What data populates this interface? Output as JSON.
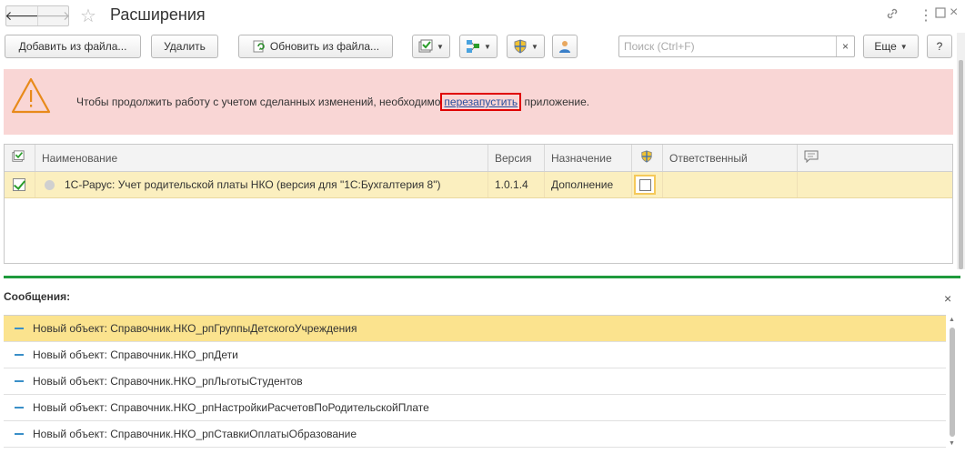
{
  "window": {
    "title": "Расширения",
    "nav_back_icon": "arrow-left-icon",
    "nav_forward_icon": "arrow-right-icon",
    "favorite_icon": "star-icon",
    "link_icon": "link-icon",
    "menu_icon": "more-vertical-icon",
    "maximize_icon": "maximize-icon",
    "close_icon": "close-icon"
  },
  "toolbar": {
    "add_from_file": "Добавить из файла...",
    "delete": "Удалить",
    "update_from_file": "Обновить из файла...",
    "search_placeholder": "Поиск (Ctrl+F)",
    "search_clear": "×",
    "more": "Еще",
    "help": "?"
  },
  "warning": {
    "text_before": "Чтобы продолжить работу с учетом сделанных изменений, необходимо",
    "link": "перезапустить",
    "text_after": " приложение."
  },
  "table": {
    "columns": {
      "name": "Наименование",
      "version": "Версия",
      "purpose": "Назначение",
      "responsible": "Ответственный"
    },
    "rows": [
      {
        "checked": true,
        "name": "1С-Рарус: Учет родительской платы НКО (версия для \"1С:Бухгалтерия 8\")",
        "version": "1.0.1.4",
        "purpose": "Дополнение",
        "safe_mode": false,
        "responsible": ""
      }
    ]
  },
  "messages": {
    "title": "Сообщения:",
    "close": "×",
    "items": [
      "Новый объект: Справочник.НКО_рпГруппыДетскогоУчреждения",
      "Новый объект: Справочник.НКО_рпДети",
      "Новый объект: Справочник.НКО_рпЛьготыСтудентов",
      "Новый объект: Справочник.НКО_рпНастройкиРасчетовПоРодительскойПлате",
      "Новый объект: Справочник.НКО_рпСтавкиОплатыОбразование"
    ]
  },
  "colors": {
    "warning_bg": "#f9d6d5",
    "selected_row": "#fbefbf",
    "active_message": "#fbe38e",
    "separator": "#1e9a3c",
    "link_highlight": "#e00000"
  }
}
